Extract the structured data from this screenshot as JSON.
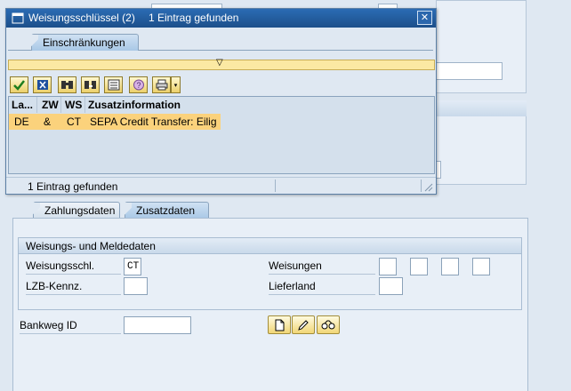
{
  "popup": {
    "title": "Weisungsschlüssel (2)",
    "title_status": "1 Eintrag gefunden",
    "restrictions_tab": "Einschränkungen",
    "toolbar_icons": [
      "checkmark-icon",
      "cancel-icon",
      "find-icon",
      "find-next-icon",
      "settings-icon",
      "help-icon",
      "print-icon",
      "dropdown-icon"
    ],
    "columns": [
      "La...",
      "ZW",
      "WS",
      "Zusatzinformation"
    ],
    "rows": [
      {
        "la": "DE",
        "zw": "&",
        "ws": "CT",
        "info": "SEPA Credit Transfer: Eilig"
      }
    ],
    "status": "1 Eintrag gefunden"
  },
  "tabs": {
    "zahlungsdaten": "Zahlungsdaten",
    "zusatzdaten": "Zusatzdaten"
  },
  "group": {
    "title": "Weisungs- und Meldedaten",
    "weisungsschl_label": "Weisungsschl.",
    "weisungsschl_value": "CT",
    "lzb_label": "LZB-Kennz.",
    "lzb_value": "",
    "weisungen_label": "Weisungen",
    "weisungen_values": [
      "",
      "",
      "",
      ""
    ],
    "lieferland_label": "Lieferland",
    "lieferland_value": ""
  },
  "bankweg": {
    "label": "Bankweg ID",
    "value": "",
    "buttons": [
      "create-icon",
      "edit-icon",
      "display-icon"
    ]
  },
  "colors": {
    "title_bar": "#1c4f8a",
    "selected_row": "#fbd27c",
    "toolbar_button": "#ecd06a"
  }
}
